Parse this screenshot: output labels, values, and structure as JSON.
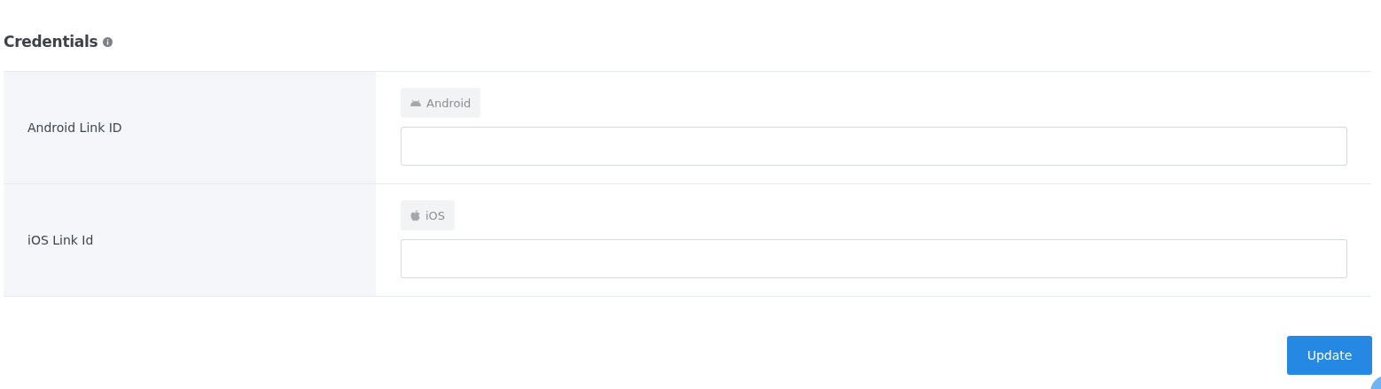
{
  "section": {
    "title": "Credentials"
  },
  "rows": [
    {
      "label": "Android Link ID",
      "tag": "Android",
      "kind": "android"
    },
    {
      "label": "iOS Link Id",
      "tag": "iOS",
      "kind": "ios"
    }
  ],
  "buttons": [
    "Update"
  ]
}
